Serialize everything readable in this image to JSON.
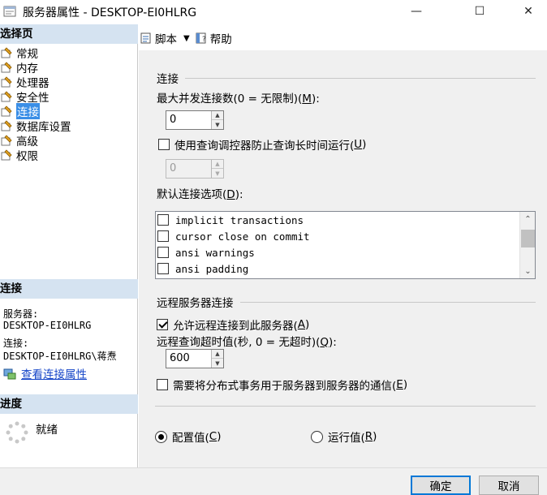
{
  "window": {
    "title": "服务器属性 - DESKTOP-EI0HLRG",
    "minimize": "—",
    "maximize": "☐",
    "close": "✕"
  },
  "left": {
    "select_page_header": "选择页",
    "pages": [
      {
        "label": "常规",
        "icon": "wrench-page-icon"
      },
      {
        "label": "内存",
        "icon": "wrench-page-icon"
      },
      {
        "label": "处理器",
        "icon": "wrench-page-icon"
      },
      {
        "label": "安全性",
        "icon": "wrench-page-icon"
      },
      {
        "label": "连接",
        "icon": "wrench-page-icon",
        "selected": true
      },
      {
        "label": "数据库设置",
        "icon": "wrench-page-icon"
      },
      {
        "label": "高级",
        "icon": "wrench-page-icon"
      },
      {
        "label": "权限",
        "icon": "wrench-page-icon"
      }
    ],
    "connection_header": "连接",
    "server_label": "服务器:",
    "server_value": "DESKTOP-EI0HLRG",
    "conn_label": "连接:",
    "conn_value": "DESKTOP-EI0HLRG\\蒋焘",
    "view_conn_props": "查看连接属性",
    "progress_header": "进度",
    "progress_status": "就绪"
  },
  "toolbar": {
    "script_label": "脚本",
    "help_label": "帮助"
  },
  "connection": {
    "group_title": "连接",
    "max_conn_label_a": "最大并发连接数(0 = 无限制)(",
    "max_conn_key": "M",
    "max_conn_label_b": "):",
    "max_conn_value": "0",
    "query_governor_label_a": "使用查询调控器防止查询长时间运行(",
    "query_governor_key": "U",
    "query_governor_label_b": ")",
    "query_governor_checked": false,
    "query_governor_value": "0",
    "default_options_label_a": "默认连接选项(",
    "default_options_key": "D",
    "default_options_label_b": "):",
    "options": [
      {
        "label": "implicit transactions",
        "checked": false
      },
      {
        "label": "cursor close on commit",
        "checked": false
      },
      {
        "label": "ansi warnings",
        "checked": false
      },
      {
        "label": "ansi padding",
        "checked": false
      }
    ]
  },
  "remote": {
    "group_title": "远程服务器连接",
    "allow_remote_label_a": "允许远程连接到此服务器(",
    "allow_remote_key": "A",
    "allow_remote_label_b": ")",
    "allow_remote_checked": true,
    "timeout_label_a": "远程查询超时值(秒, 0 = 无超时)(",
    "timeout_key": "Q",
    "timeout_label_b": "):",
    "timeout_value": "600",
    "distributed_label_a": "需要将分布式事务用于服务器到服务器的通信(",
    "distributed_key": "E",
    "distributed_label_b": ")",
    "distributed_checked": false
  },
  "values_mode": {
    "configured_a": "配置值(",
    "configured_key": "C",
    "configured_b": ")",
    "running_a": "运行值(",
    "running_key": "R",
    "running_b": ")",
    "selected": "configured"
  },
  "footer": {
    "ok": "确定",
    "cancel": "取消"
  }
}
